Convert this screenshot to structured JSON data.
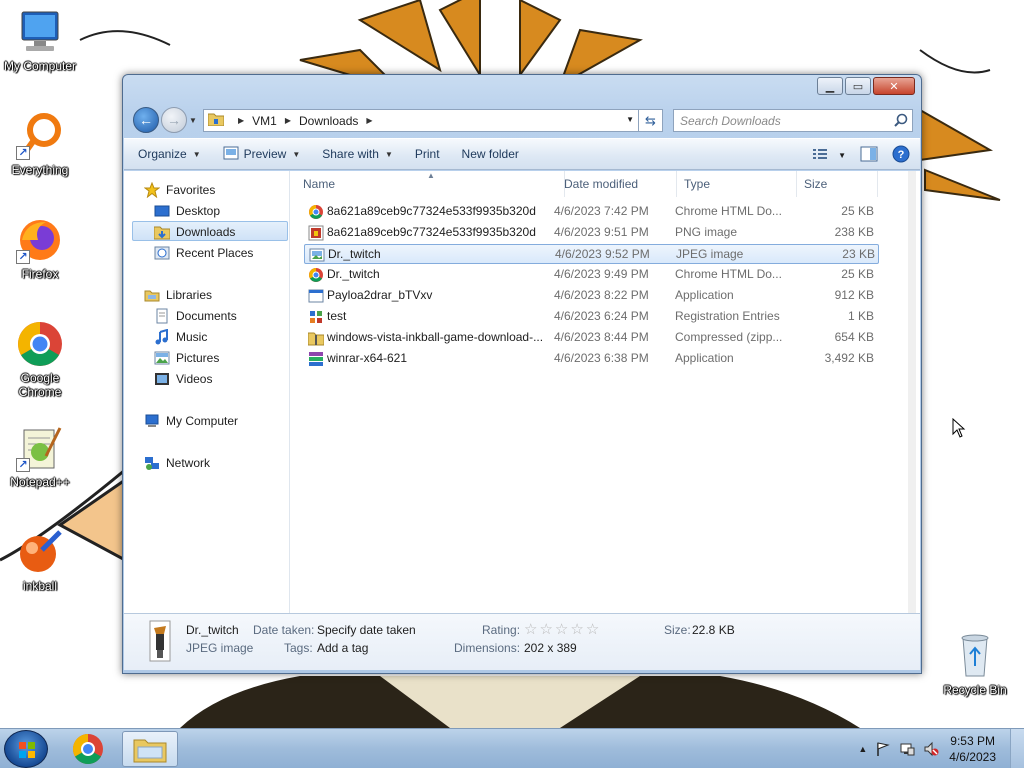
{
  "desktop": {
    "icons": [
      {
        "label": "My Computer",
        "icon": "computer-icon"
      },
      {
        "label": "Everything",
        "icon": "everything-search-icon"
      },
      {
        "label": "Firefox",
        "icon": "firefox-icon"
      },
      {
        "label": "Google Chrome",
        "icon": "chrome-icon"
      },
      {
        "label": "Notepad++",
        "icon": "notepadpp-icon"
      },
      {
        "label": "inkball",
        "icon": "inkball-icon"
      },
      {
        "label": "Recycle Bin",
        "icon": "recycle-bin-icon"
      }
    ]
  },
  "window": {
    "breadcrumb": [
      "VM1",
      "Downloads"
    ],
    "search_placeholder": "Search Downloads",
    "toolbar": {
      "organize": "Organize",
      "preview": "Preview",
      "share_with": "Share with",
      "print": "Print",
      "new_folder": "New folder"
    },
    "nav_pane": {
      "favorites": "Favorites",
      "desktop": "Desktop",
      "downloads": "Downloads",
      "recent_places": "Recent Places",
      "libraries": "Libraries",
      "documents": "Documents",
      "music": "Music",
      "pictures": "Pictures",
      "videos": "Videos",
      "my_computer": "My Computer",
      "network": "Network"
    },
    "columns": {
      "name": "Name",
      "date": "Date modified",
      "type": "Type",
      "size": "Size"
    },
    "files": [
      {
        "name": "8a621a89ceb9c77324e533f9935b320d",
        "date": "4/6/2023 7:42 PM",
        "type": "Chrome HTML Do...",
        "size": "25 KB",
        "icon": "chrome-html-icon"
      },
      {
        "name": "8a621a89ceb9c77324e533f9935b320d",
        "date": "4/6/2023 9:51 PM",
        "type": "PNG image",
        "size": "238 KB",
        "icon": "png-image-icon"
      },
      {
        "name": "Dr._twitch",
        "date": "4/6/2023 9:52 PM",
        "type": "JPEG image",
        "size": "23 KB",
        "icon": "jpeg-image-icon",
        "selected": true
      },
      {
        "name": "Dr._twitch",
        "date": "4/6/2023 9:49 PM",
        "type": "Chrome HTML Do...",
        "size": "25 KB",
        "icon": "chrome-html-icon"
      },
      {
        "name": "Payloa2drar_bTVxv",
        "date": "4/6/2023 8:22 PM",
        "type": "Application",
        "size": "912 KB",
        "icon": "application-icon"
      },
      {
        "name": "test",
        "date": "4/6/2023 6:24 PM",
        "type": "Registration Entries",
        "size": "1 KB",
        "icon": "registry-icon"
      },
      {
        "name": "windows-vista-inkball-game-download-...",
        "date": "4/6/2023 8:44 PM",
        "type": "Compressed (zipp...",
        "size": "654 KB",
        "icon": "zip-folder-icon"
      },
      {
        "name": "winrar-x64-621",
        "date": "4/6/2023 6:38 PM",
        "type": "Application",
        "size": "3,492 KB",
        "icon": "winrar-icon"
      }
    ],
    "details": {
      "file_name": "Dr._twitch",
      "file_type": "JPEG image",
      "date_taken_label": "Date taken:",
      "date_taken_value": "Specify date taken",
      "tags_label": "Tags:",
      "tags_value": "Add a tag",
      "rating_label": "Rating:",
      "rating_stars": 0,
      "dimensions_label": "Dimensions:",
      "dimensions_value": "202 x 389",
      "size_label": "Size:",
      "size_value": "22.8 KB"
    }
  },
  "taskbar": {
    "time": "9:53 PM",
    "date": "4/6/2023"
  },
  "colors": {
    "selection": "#cfe2f7",
    "window_frame": "#b9d1ec",
    "taskbar": "#9fbcdb"
  }
}
